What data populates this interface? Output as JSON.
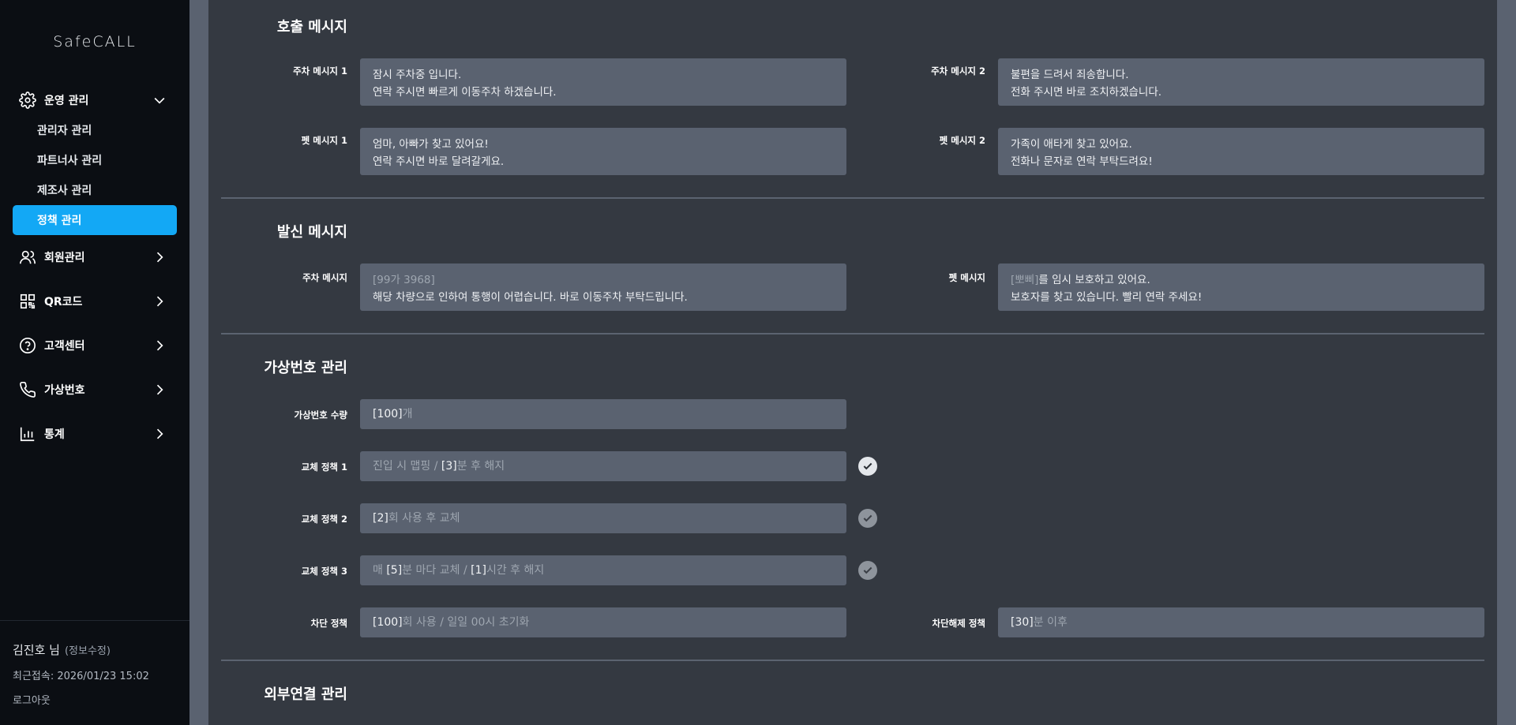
{
  "app": {
    "logo": "SafeCALL"
  },
  "sidebar": {
    "operations": {
      "label": "운영 관리",
      "icon": "gear-icon"
    },
    "sub_items": [
      "관리자 관리",
      "파트너사 관리",
      "제조사 관리",
      "정책 관리"
    ],
    "members": {
      "label": "회원관리",
      "icon": "users-icon"
    },
    "qr": {
      "label": "QR코드",
      "icon": "qr-code-icon"
    },
    "support": {
      "label": "고객센터",
      "icon": "help-circle-icon"
    },
    "virtual": {
      "label": "가상번호",
      "icon": "phone-icon"
    },
    "stats": {
      "label": "통계",
      "icon": "bar-chart-icon"
    }
  },
  "user": {
    "name": "김진호 님",
    "edit": "(정보수정)",
    "last_login": "최근접속: 2026/01/23 15:02",
    "logout": "로그아웃"
  },
  "call_messages": {
    "title": "호출 메시지",
    "parking1": {
      "label": "주차 메시지 1",
      "lines": [
        "잠시 주차중 입니다.",
        "연락 주시면 빠르게 이동주차 하겠습니다."
      ]
    },
    "parking2": {
      "label": "주차 메시지 2",
      "lines": [
        "불편을 드려서 죄송합니다.",
        "전화 주시면 바로 조치하겠습니다."
      ]
    },
    "pet1": {
      "label": "펫 메시지 1",
      "lines": [
        "엄마, 아빠가 찾고 있어요!",
        "연락 주시면 바로 달려갈게요."
      ]
    },
    "pet2": {
      "label": "펫 메시지 2",
      "lines": [
        "가족이 애타게 찾고 있어요.",
        "전화나 문자로 연락 부탁드려요!"
      ]
    }
  },
  "send_messages": {
    "title": "발신 메시지",
    "parking": {
      "label": "주차 메시지",
      "placeholder": "[99가 3968]",
      "line2": "해당 차량으로 인하여 통행이 어렵습니다. 바로 이동주차 부탁드립니다."
    },
    "pet": {
      "label": "펫 메시지",
      "placeholder": "[뽀삐]",
      "line1_rest": "를 임시 보호하고 있어요.",
      "line2": "보호자를 찾고 있습니다. 빨리 연락 주세요!"
    }
  },
  "virtual_numbers": {
    "title": "가상번호 관리",
    "count": {
      "label": "가상번호 수량",
      "value": "[100]",
      "suffix": "개"
    },
    "policy1": {
      "label": "교체 정책 1",
      "prefix": "진입 시 맵핑 / ",
      "value": "[3]",
      "suffix": "분 후 해지",
      "checked": true
    },
    "policy2": {
      "label": "교체 정책 2",
      "value": "[2]",
      "suffix": "회 사용 후 교체",
      "checked": false
    },
    "policy3": {
      "label": "교체 정책 3",
      "prefix": "매 ",
      "value1": "[5]",
      "mid": "분 마다 교체 / ",
      "value2": "[1]",
      "suffix": "시간 후 해지",
      "checked": false
    },
    "block": {
      "label": "차단 정책",
      "value": "[100]",
      "suffix": "회 사용 / 일일 00시 초기화"
    },
    "unblock": {
      "label": "차단해제 정책",
      "value": "[30]",
      "suffix": "분 이후"
    }
  },
  "external": {
    "title": "외부연결 관리"
  }
}
